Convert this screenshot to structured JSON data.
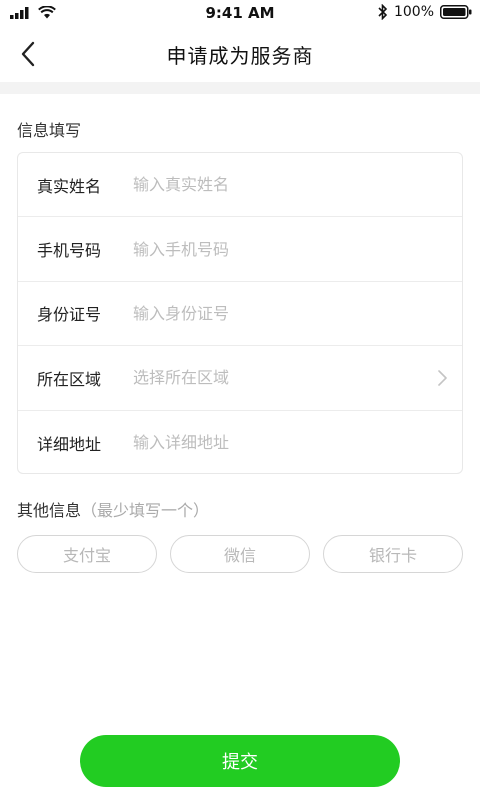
{
  "status_bar": {
    "time": "9:41 AM",
    "battery": "100%"
  },
  "nav": {
    "title": "申请成为服务商"
  },
  "info_section": {
    "title": "信息填写",
    "fields": [
      {
        "label": "真实姓名",
        "placeholder": "输入真实姓名",
        "value": ""
      },
      {
        "label": "手机号码",
        "placeholder": "输入手机号码",
        "value": ""
      },
      {
        "label": "身份证号",
        "placeholder": "输入身份证号",
        "value": ""
      },
      {
        "label": "所在区域",
        "placeholder": "选择所在区域",
        "value": ""
      },
      {
        "label": "详细地址",
        "placeholder": "输入详细地址",
        "value": ""
      }
    ]
  },
  "other_section": {
    "title": "其他信息",
    "hint": "（最少填写一个）",
    "options": [
      "支付宝",
      "微信",
      "银行卡"
    ]
  },
  "submit": {
    "label": "提交"
  },
  "colors": {
    "accent": "#22cc22",
    "placeholder": "#bdbdbd"
  }
}
